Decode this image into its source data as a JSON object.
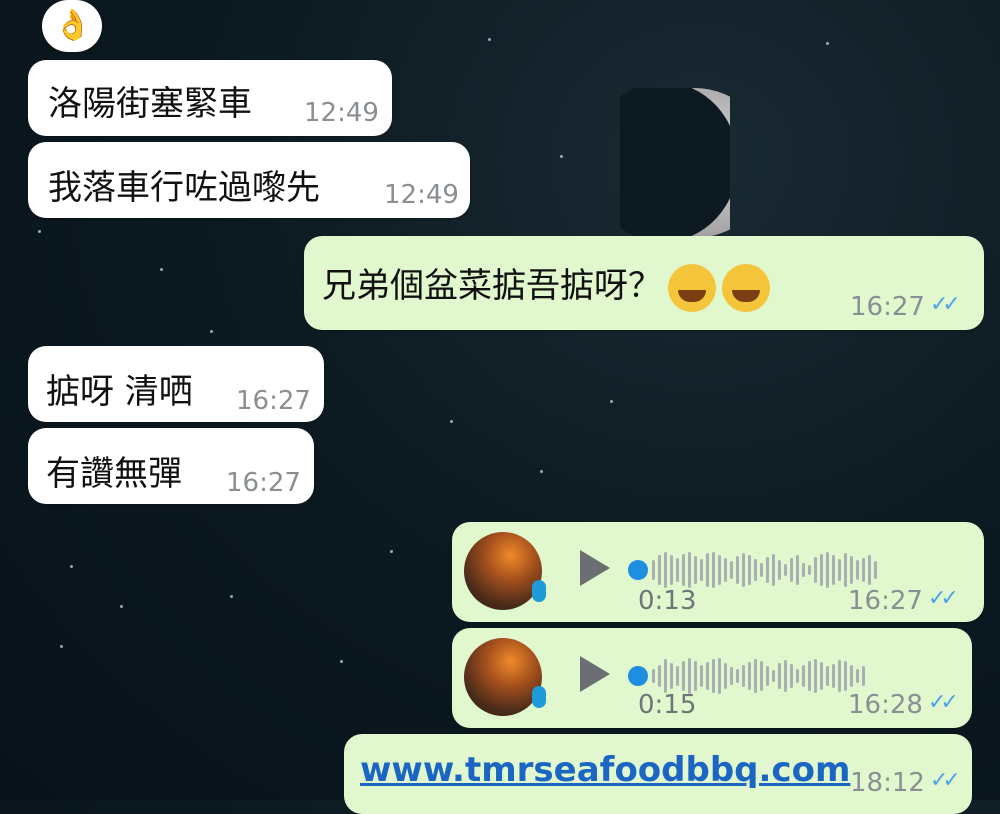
{
  "chat": {
    "emoji_reaction": "👌",
    "messages": [
      {
        "text": "洛陽街塞緊車",
        "time": "12:49"
      },
      {
        "text": "我落車行咗過嚟先",
        "time": "12:49"
      },
      {
        "text": "兄弟個盆菜掂吾掂呀？",
        "time": "16:27"
      },
      {
        "text": "掂呀 清哂",
        "time": "16:27"
      },
      {
        "text": "有讚無彈",
        "time": "16:27"
      }
    ],
    "voice_notes": [
      {
        "duration": "0:13",
        "time": "16:27"
      },
      {
        "duration": "0:15",
        "time": "16:28"
      }
    ],
    "link_message": {
      "text": "www.tmrseafoodbbq.com",
      "time": "18:12"
    }
  },
  "colors": {
    "incoming": "#ffffff",
    "outgoing": "#e1f8cf",
    "tick": "#4fa3e6",
    "link": "#1a66c2"
  }
}
